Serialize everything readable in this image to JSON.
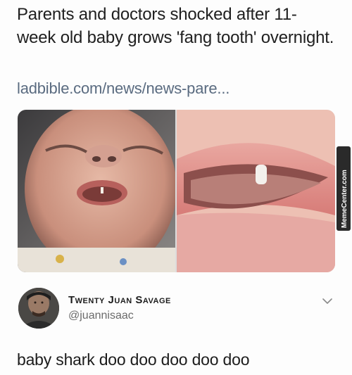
{
  "headline": "Parents and doctors shocked after 11-week old baby grows 'fang tooth' overnight.",
  "link": "ladbible.com/news/news-pare...",
  "photos": {
    "left_icon": "baby-face-photo",
    "right_icon": "baby-mouth-tooth-photo"
  },
  "watermark": "MemeCenter.com",
  "tweet": {
    "display_name": "Twenty Juan Savage",
    "handle": "@juannisaac",
    "text": "baby shark doo doo doo doo doo"
  },
  "icons": {
    "avatar": "user-avatar",
    "more": "chevron-down-icon"
  },
  "colors": {
    "link": "#5a6b80",
    "handle": "#6b6b6b",
    "watermark_bg": "#2a2a2a"
  }
}
